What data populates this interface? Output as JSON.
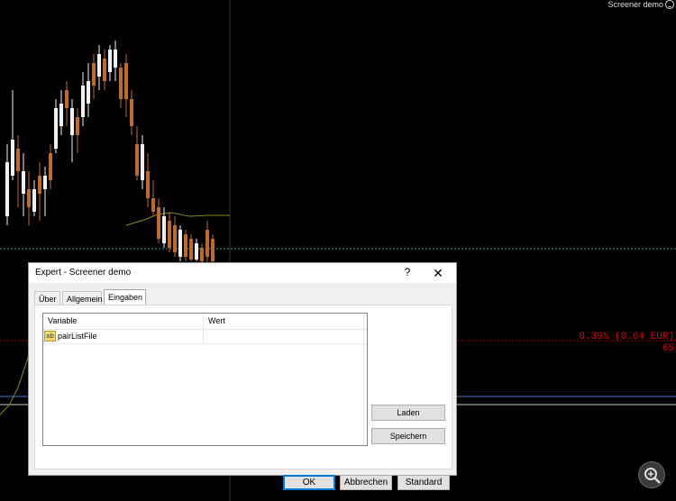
{
  "chart": {
    "title": "Screener demo",
    "pct_label": "0.39% (0.64 EUR)",
    "num_label": "65"
  },
  "dialog": {
    "title": "Expert - Screener demo",
    "help_glyph": "?",
    "close_glyph": "✕",
    "tabs": [
      {
        "label": "Über",
        "active": false
      },
      {
        "label": "Allgemein",
        "active": false
      },
      {
        "label": "Eingaben",
        "active": true
      }
    ],
    "grid": {
      "columns": [
        "Variable",
        "Wert"
      ],
      "rows": [
        {
          "icon": "ab",
          "variable": "pairListFile",
          "value": ""
        }
      ]
    },
    "side_buttons": {
      "load": "Laden",
      "save": "Speichern"
    },
    "bottom_buttons": {
      "ok": "OK",
      "cancel": "Abbrechen",
      "default": "Standard"
    }
  },
  "colors": {
    "chart_bg": "#000000",
    "candle_up": "#f0f0f0",
    "candle_down": "#c06a2a",
    "ma_line": "#8a8a1a",
    "price_line": "#3a9a9a",
    "blue_line": "#3a7ad8",
    "accent": "#0078d7"
  }
}
